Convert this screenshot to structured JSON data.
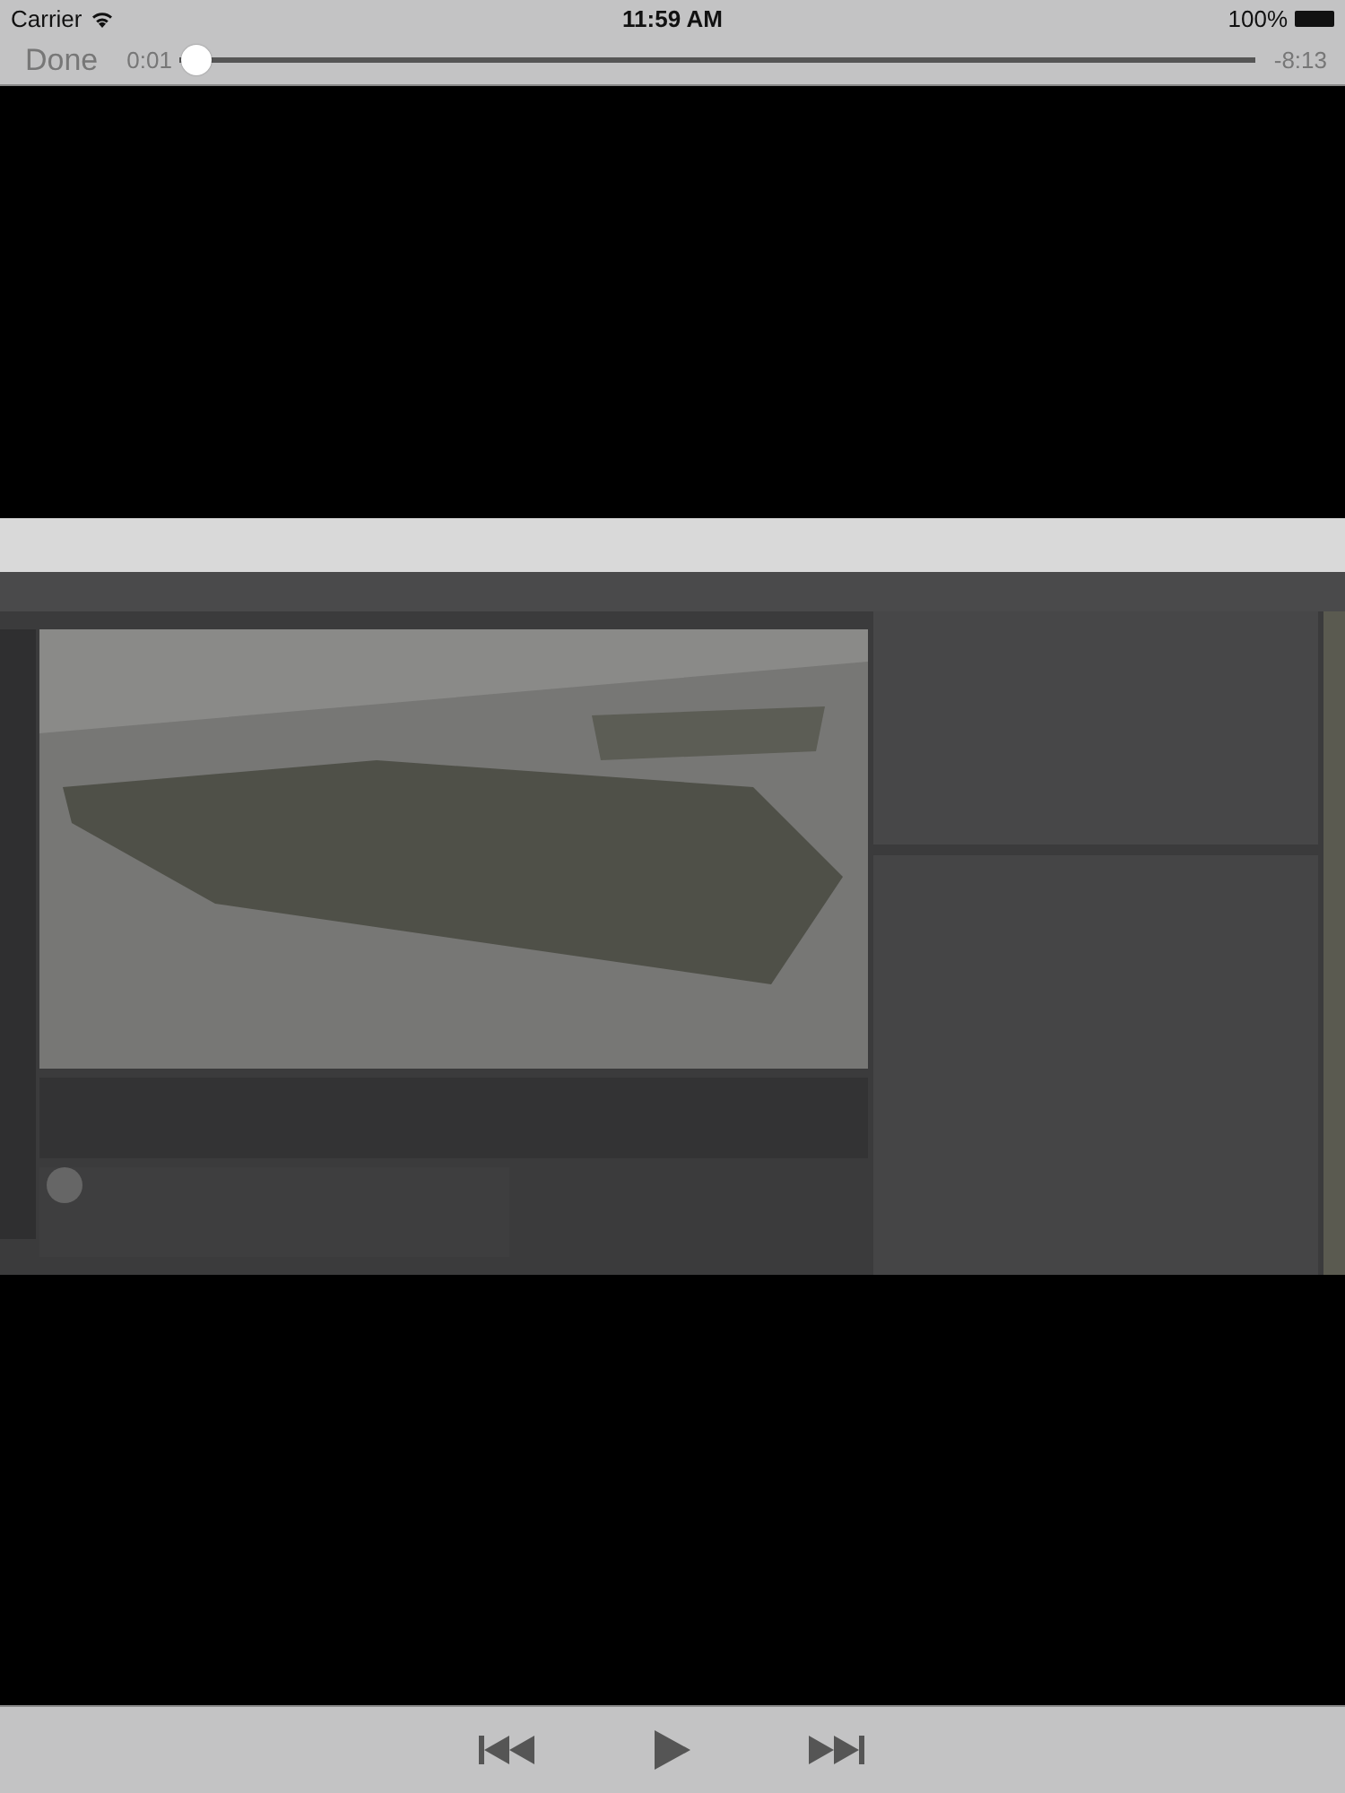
{
  "status_bar": {
    "carrier": "Carrier",
    "time": "11:59 AM",
    "battery": "100%"
  },
  "player": {
    "done": "Done",
    "elapsed": "0:01",
    "remaining": "-8:13",
    "scrubber": {
      "level": 0.002
    }
  }
}
